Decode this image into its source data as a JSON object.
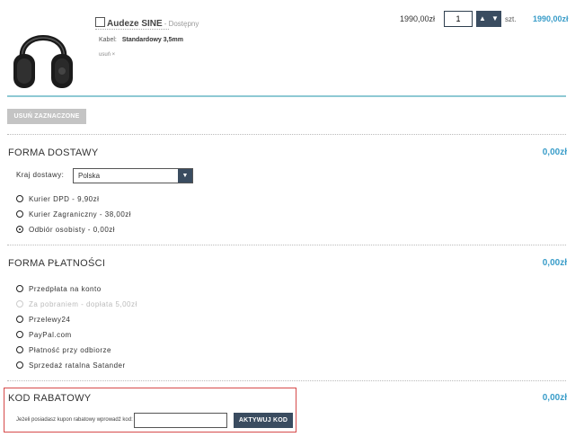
{
  "product": {
    "name": "Audeze SINE",
    "availability": "- Dostępny",
    "option_label": "Kabel:",
    "option_value": "Standardowy 3,5mm",
    "remove_label": "usuń ×",
    "unit_price": "1990,00zł",
    "quantity": "1",
    "unit": "szt.",
    "line_total": "1990,00zł"
  },
  "remove_selected_label": "USUŃ ZAZNACZONE",
  "shipping": {
    "title": "FORMA DOSTAWY",
    "price": "0,00zł",
    "country_label": "Kraj dostawy:",
    "country_value": "Polska",
    "options": [
      {
        "label": "Kurier DPD - 9,90zł",
        "selected": false,
        "disabled": false
      },
      {
        "label": "Kurier Zagraniczny - 38,00zł",
        "selected": false,
        "disabled": false
      },
      {
        "label": "Odbiór osobisty - 0,00zł",
        "selected": true,
        "disabled": false
      }
    ]
  },
  "payment": {
    "title": "FORMA PŁATNOŚCI",
    "price": "0,00zł",
    "options": [
      {
        "label": "Przedpłata na konto",
        "selected": false,
        "disabled": false
      },
      {
        "label": "Za pobraniem - dopłata 5,00zł",
        "selected": false,
        "disabled": true
      },
      {
        "label": "Przelewy24",
        "selected": false,
        "disabled": false
      },
      {
        "label": "PayPal.com",
        "selected": false,
        "disabled": false
      },
      {
        "label": "Płatność przy odbiorze",
        "selected": false,
        "disabled": false
      },
      {
        "label": "Sprzedaż ratalna Satander",
        "selected": false,
        "disabled": false
      }
    ]
  },
  "discount": {
    "title": "KOD RABATOWY",
    "price": "0,00zł",
    "prompt": "Jeżeli posiadasz kupon rabatowy wprowadź kod:",
    "input_value": "",
    "button_label": "AKTYWUJ KOD"
  },
  "colors": {
    "accent": "#3a9dc9",
    "dark_button": "#3a4c60",
    "highlight_border": "#d64a4a"
  }
}
